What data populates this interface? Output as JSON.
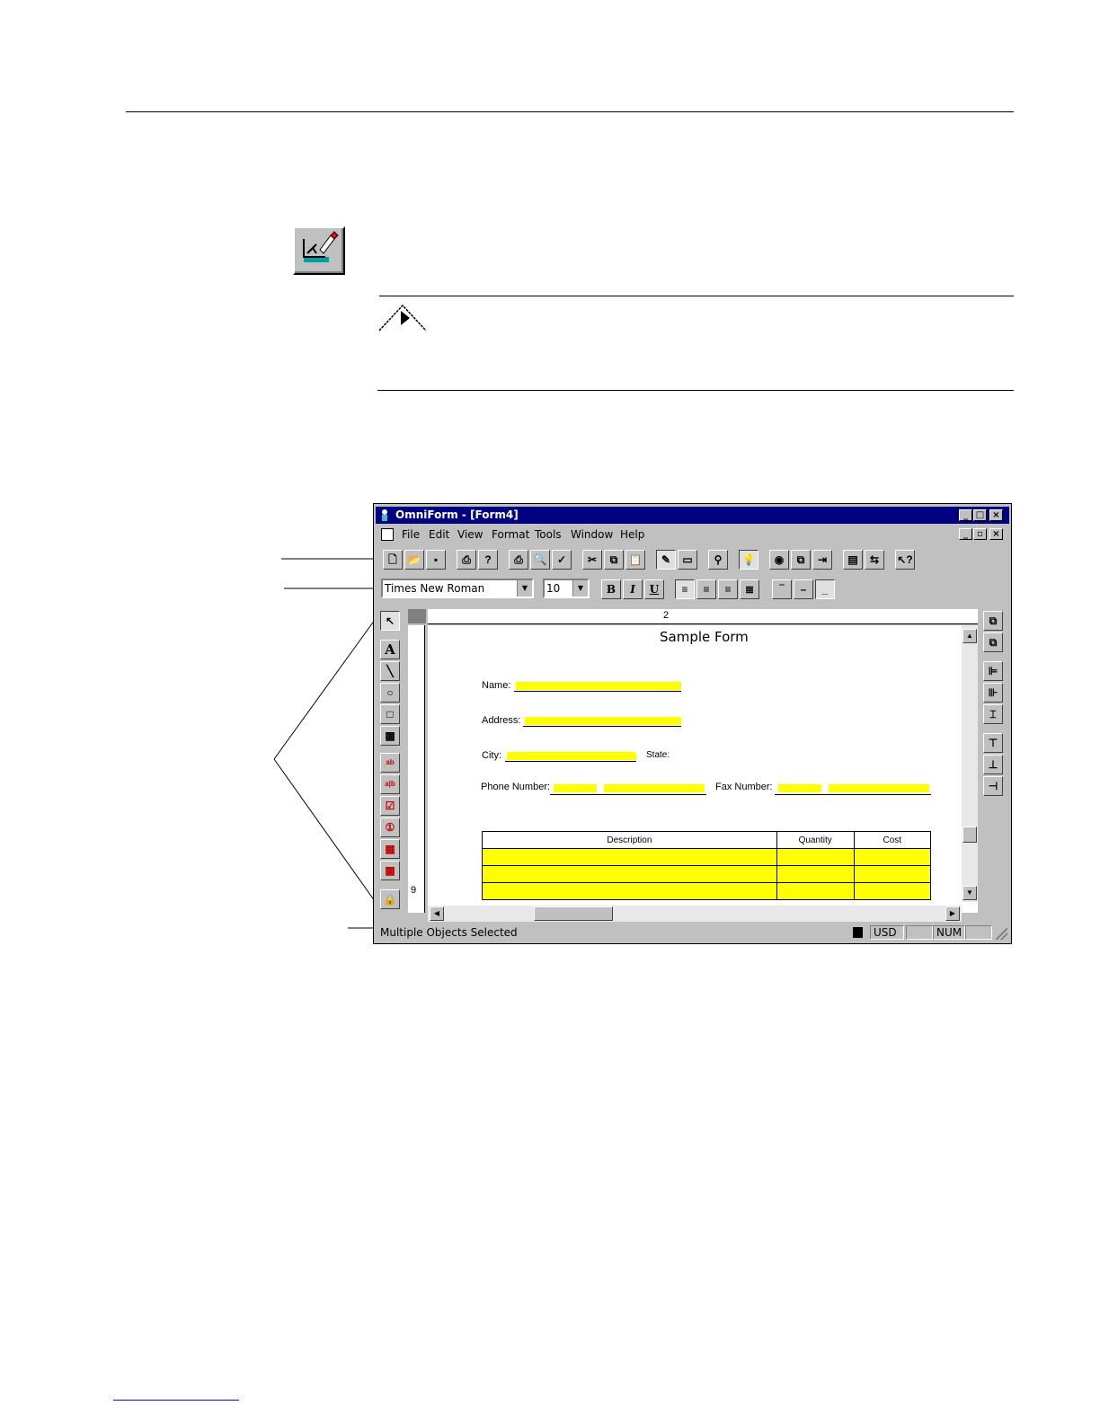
{
  "window": {
    "title": "OmniForm - [Form4]",
    "menu": [
      "File",
      "Edit",
      "View",
      "Format",
      "Tools",
      "Window",
      "Help"
    ],
    "font_name": "Times New Roman",
    "font_size": "10",
    "format_buttons": [
      "B",
      "I",
      "U"
    ],
    "ruler_number": "2",
    "vruler_number": "9"
  },
  "form": {
    "title": "Sample Form",
    "labels": {
      "name": "Name:",
      "address": "Address:",
      "city": "City:",
      "state": "State:",
      "phone": "Phone Number:",
      "fax": "Fax Number:"
    },
    "table_headers": [
      "Description",
      "Quantity",
      "Cost"
    ]
  },
  "status": {
    "message": "Multiple Objects Selected",
    "currency": "USD",
    "num": "NUM"
  },
  "icons": [
    "selection-arrow-icon",
    "text-tool-icon",
    "line-tool-icon",
    "ellipse-tool-icon",
    "rectangle-tool-icon",
    "picture-tool-icon",
    "field-tool-icon",
    "comb-field-icon",
    "checkbox-tool-icon",
    "radio-tool-icon",
    "table-tool-icon",
    "image-field-icon",
    "lock-icon"
  ]
}
